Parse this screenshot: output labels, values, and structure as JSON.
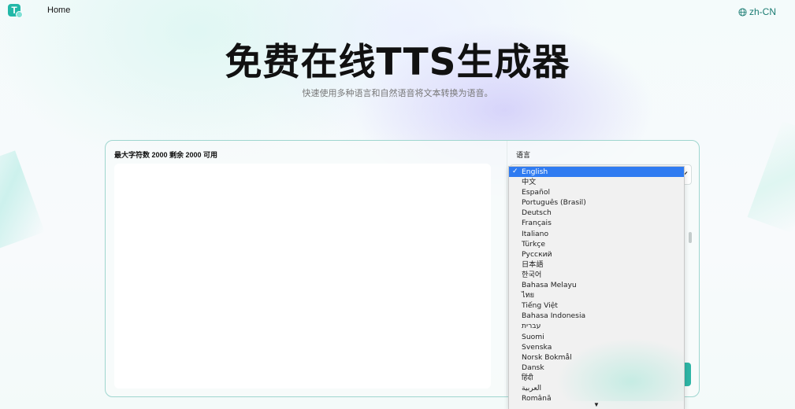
{
  "header": {
    "logo_letter": "T",
    "nav_home": "Home",
    "language_switch": "zh-CN"
  },
  "hero": {
    "title": "免费在线TTS生成器",
    "subtitle": "快速使用多种语言和自然语音将文本转换为语音。"
  },
  "editor": {
    "char_info": "最大字符数 2000 剩余 2000 可用",
    "text_value": ""
  },
  "settings": {
    "language_label": "语言",
    "selected_language": "English"
  },
  "language_dropdown": {
    "options": [
      "English",
      "中文",
      "Español",
      "Português (Brasil)",
      "Deutsch",
      "Français",
      "Italiano",
      "Türkçe",
      "Русский",
      "日本語",
      "한국어",
      "Bahasa Melayu",
      "ไทย",
      "Tiếng Việt",
      "Bahasa Indonesia",
      "עברית",
      "Suomi",
      "Svenska",
      "Norsk Bokmål",
      "Dansk",
      "हिंदी",
      "العربية",
      "Română"
    ],
    "selected_index": 0,
    "check_mark": "✓",
    "more_arrow": "▼"
  },
  "colors": {
    "accent": "#2db5a5",
    "selected_option": "#2f7bf1",
    "panel_border": "#9fd6cf"
  },
  "icons": {
    "globe": "globe-icon",
    "chevron": "chevron-down-icon"
  }
}
